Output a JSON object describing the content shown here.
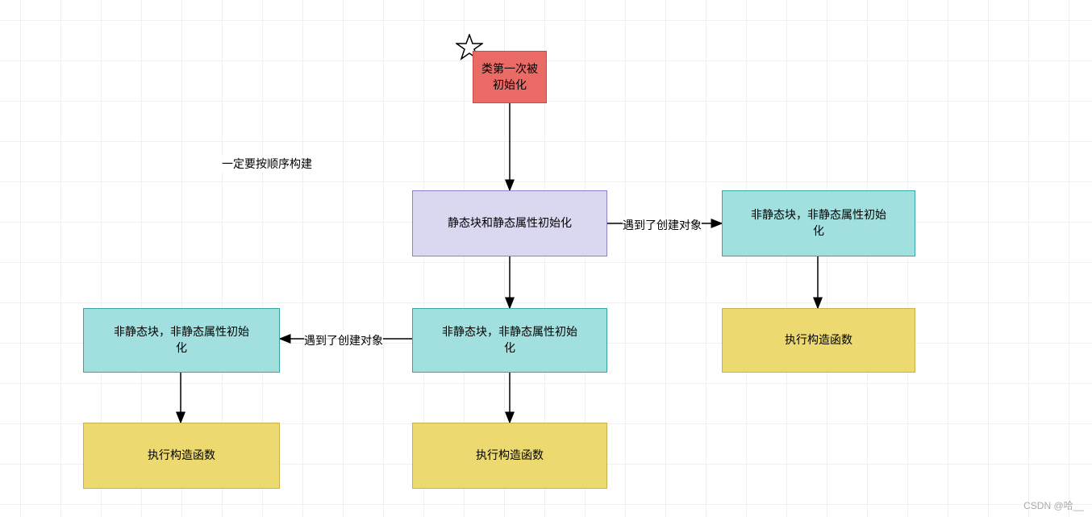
{
  "nodes": {
    "start": {
      "text": "类第一次被\n初始化"
    },
    "static_init": {
      "text": "静态块和静态属性初始化"
    },
    "nonstatic_mid": {
      "text": "非静态块，非静态属性初始\n化"
    },
    "nonstatic_left": {
      "text": "非静态块，非静态属性初始\n化"
    },
    "nonstatic_right": {
      "text": "非静态块，非静态属性初始\n化"
    },
    "ctor_left": {
      "text": "执行构造函数"
    },
    "ctor_mid": {
      "text": "执行构造函数"
    },
    "ctor_right": {
      "text": "执行构造函数"
    }
  },
  "labels": {
    "note": "一定要按顺序构建",
    "edge_right": "遇到了创建对象",
    "edge_left": "遇到了创建对象"
  },
  "watermark": "CSDN @哈__",
  "colors": {
    "red": "#ea6b66",
    "purple": "#dad7f0",
    "teal": "#a1e0df",
    "yellow": "#ecda71",
    "arrow": "#000000"
  },
  "chart_data": {
    "type": "flowchart",
    "title": "",
    "nodes": [
      {
        "id": "start",
        "label": "类第一次被初始化",
        "color": "red"
      },
      {
        "id": "static_init",
        "label": "静态块和静态属性初始化",
        "color": "purple"
      },
      {
        "id": "nonstatic_mid",
        "label": "非静态块，非静态属性初始化",
        "color": "teal"
      },
      {
        "id": "nonstatic_left",
        "label": "非静态块，非静态属性初始化",
        "color": "teal"
      },
      {
        "id": "nonstatic_right",
        "label": "非静态块，非静态属性初始化",
        "color": "teal"
      },
      {
        "id": "ctor_mid",
        "label": "执行构造函数",
        "color": "yellow"
      },
      {
        "id": "ctor_left",
        "label": "执行构造函数",
        "color": "yellow"
      },
      {
        "id": "ctor_right",
        "label": "执行构造函数",
        "color": "yellow"
      }
    ],
    "edges": [
      {
        "from": "start",
        "to": "static_init",
        "label": ""
      },
      {
        "from": "static_init",
        "to": "nonstatic_mid",
        "label": ""
      },
      {
        "from": "static_init",
        "to": "nonstatic_right",
        "label": "遇到了创建对象"
      },
      {
        "from": "nonstatic_mid",
        "to": "nonstatic_left",
        "label": "遇到了创建对象"
      },
      {
        "from": "nonstatic_mid",
        "to": "ctor_mid",
        "label": ""
      },
      {
        "from": "nonstatic_left",
        "to": "ctor_left",
        "label": ""
      },
      {
        "from": "nonstatic_right",
        "to": "ctor_right",
        "label": ""
      }
    ],
    "annotations": [
      {
        "text": "一定要按顺序构建"
      }
    ]
  }
}
